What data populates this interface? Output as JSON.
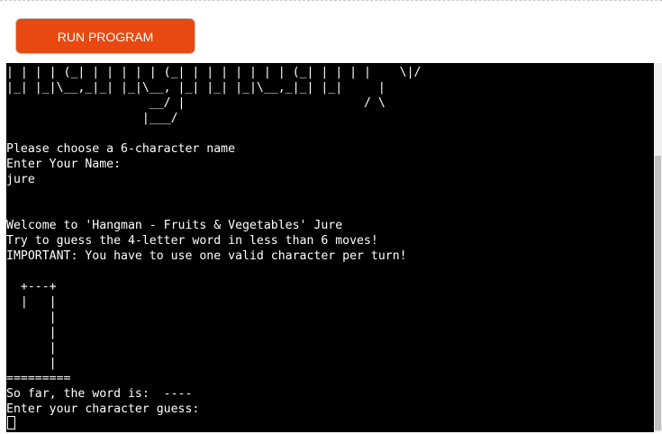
{
  "toolbar": {
    "run_label": "RUN PROGRAM"
  },
  "colors": {
    "run_button": "#e84910",
    "terminal_bg": "#000000",
    "terminal_fg": "#ffffff"
  },
  "terminal": {
    "lines": [
      "| | | | (_| | | | | | (_| | | | | | | | (_| | | | |    \\|/",
      "|_| |_|\\__,_|_| |_|\\__, |_| |_| |_|\\__,_|_| |_|     |",
      "                    __/ |                         / \\",
      "                   |___/",
      "",
      "Please choose a 6-character name",
      "Enter Your Name:",
      "jure",
      "",
      "",
      "Welcome to 'Hangman - Fruits & Vegetables' Jure",
      "Try to guess the 4-letter word in less than 6 moves!",
      "IMPORTANT: You have to use one valid character per turn!",
      "",
      "  +---+",
      "  |   |",
      "      |",
      "      |",
      "      |",
      "      |",
      "=========",
      "So far, the word is:  ----",
      "Enter your character guess:"
    ]
  }
}
